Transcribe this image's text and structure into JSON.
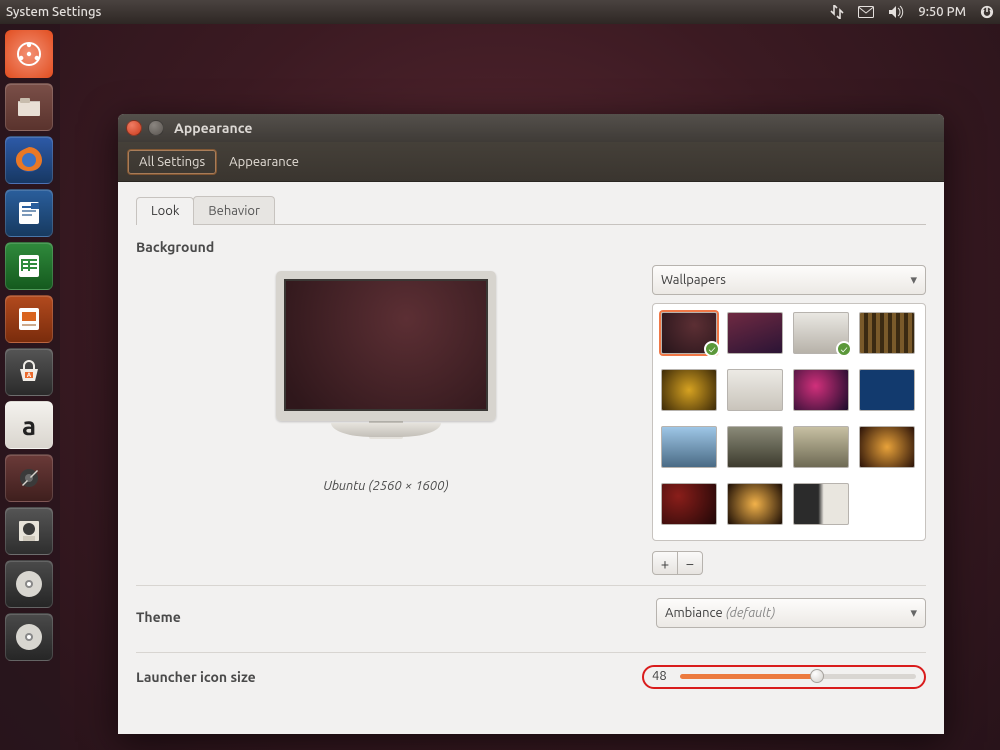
{
  "panel": {
    "title": "System Settings",
    "clock": "9:50 PM"
  },
  "launcher_items": [
    "dash",
    "files",
    "firefox",
    "writer",
    "calc",
    "impress",
    "software",
    "amazon",
    "settings",
    "disk",
    "dvd1",
    "dvd2"
  ],
  "window": {
    "title": "Appearance",
    "breadcrumbs": {
      "root": "All Settings",
      "current": "Appearance"
    },
    "tabs": {
      "look": "Look",
      "behavior": "Behavior"
    },
    "background_label": "Background",
    "preview_caption": "Ubuntu (2560 × 1600)",
    "source_dropdown": "Wallpapers",
    "theme_label": "Theme",
    "theme_value": "Ambiance",
    "theme_default": "(default)",
    "launcher_size_label": "Launcher icon size",
    "launcher_size_value": "48",
    "plus": "+",
    "minus": "−"
  }
}
